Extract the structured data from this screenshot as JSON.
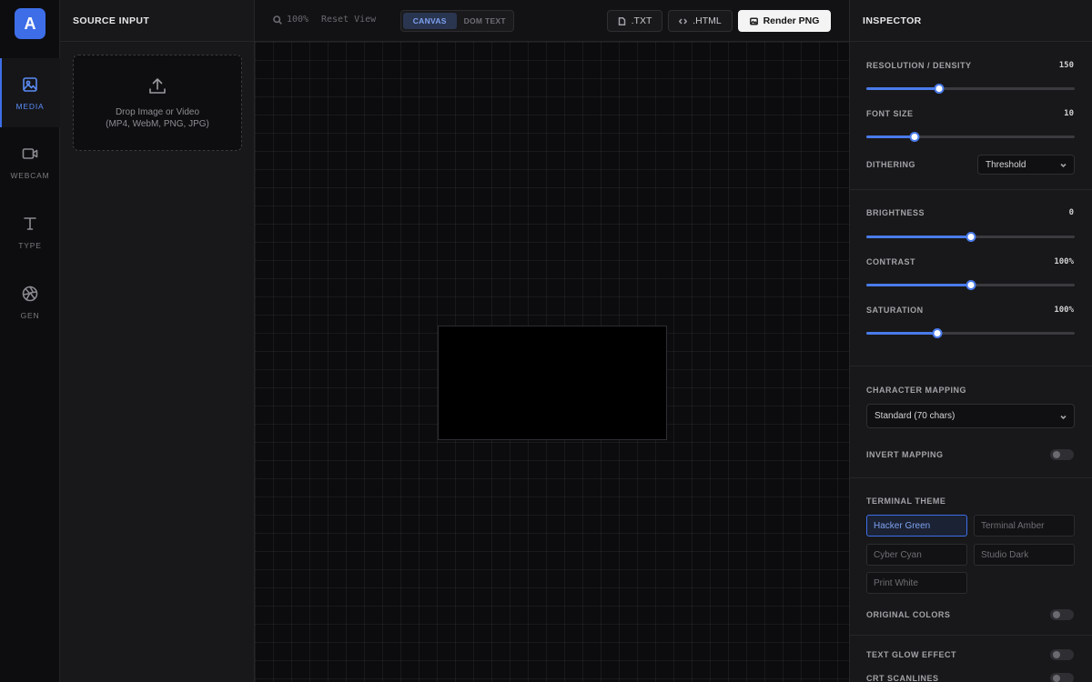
{
  "app": {
    "logo_letter": "A"
  },
  "rail": {
    "items": [
      {
        "label": "MEDIA",
        "icon": "image-icon",
        "active": true
      },
      {
        "label": "WEBCAM",
        "icon": "video-camera-icon",
        "active": false
      },
      {
        "label": "TYPE",
        "icon": "text-icon",
        "active": false
      },
      {
        "label": "GEN",
        "icon": "aperture-icon",
        "active": false
      }
    ]
  },
  "source": {
    "title": "SOURCE INPUT",
    "dropzone_line1": "Drop Image or Video",
    "dropzone_line2": "(MP4, WebM, PNG, JPG)"
  },
  "toolbar": {
    "zoom": "100%",
    "reset": "Reset View",
    "modes": [
      "CANVAS",
      "DOM TEXT"
    ],
    "active_mode": "CANVAS",
    "export_txt": ".TXT",
    "export_html": ".HTML",
    "render_png": "Render PNG"
  },
  "inspector": {
    "title": "INSPECTOR",
    "resolution": {
      "label": "RESOLUTION / DENSITY",
      "value": "150",
      "fraction": 0.35
    },
    "font_size": {
      "label": "FONT SIZE",
      "value": "10",
      "fraction": 0.23
    },
    "dithering": {
      "label": "DITHERING",
      "selected": "Threshold"
    },
    "brightness": {
      "label": "BRIGHTNESS",
      "value": "0",
      "fraction": 0.5
    },
    "contrast": {
      "label": "CONTRAST",
      "value": "100%",
      "fraction": 0.5
    },
    "saturation": {
      "label": "SATURATION",
      "value": "100%",
      "fraction": 0.34
    },
    "char_mapping": {
      "label": "CHARACTER MAPPING",
      "selected": "Standard (70 chars)"
    },
    "invert_mapping": {
      "label": "INVERT MAPPING",
      "on": false
    },
    "terminal_theme": {
      "label": "TERMINAL THEME",
      "options": [
        "Hacker Green",
        "Terminal Amber",
        "Cyber Cyan",
        "Studio Dark",
        "Print White"
      ],
      "selected": "Hacker Green"
    },
    "original_colors": {
      "label": "ORIGINAL COLORS",
      "on": false
    },
    "text_glow": {
      "label": "TEXT GLOW EFFECT",
      "on": false
    },
    "crt_scanlines": {
      "label": "CRT SCANLINES",
      "on": false
    }
  },
  "colors": {
    "accent": "#3d6ee8",
    "background": "#111113",
    "panel": "#18181a"
  }
}
